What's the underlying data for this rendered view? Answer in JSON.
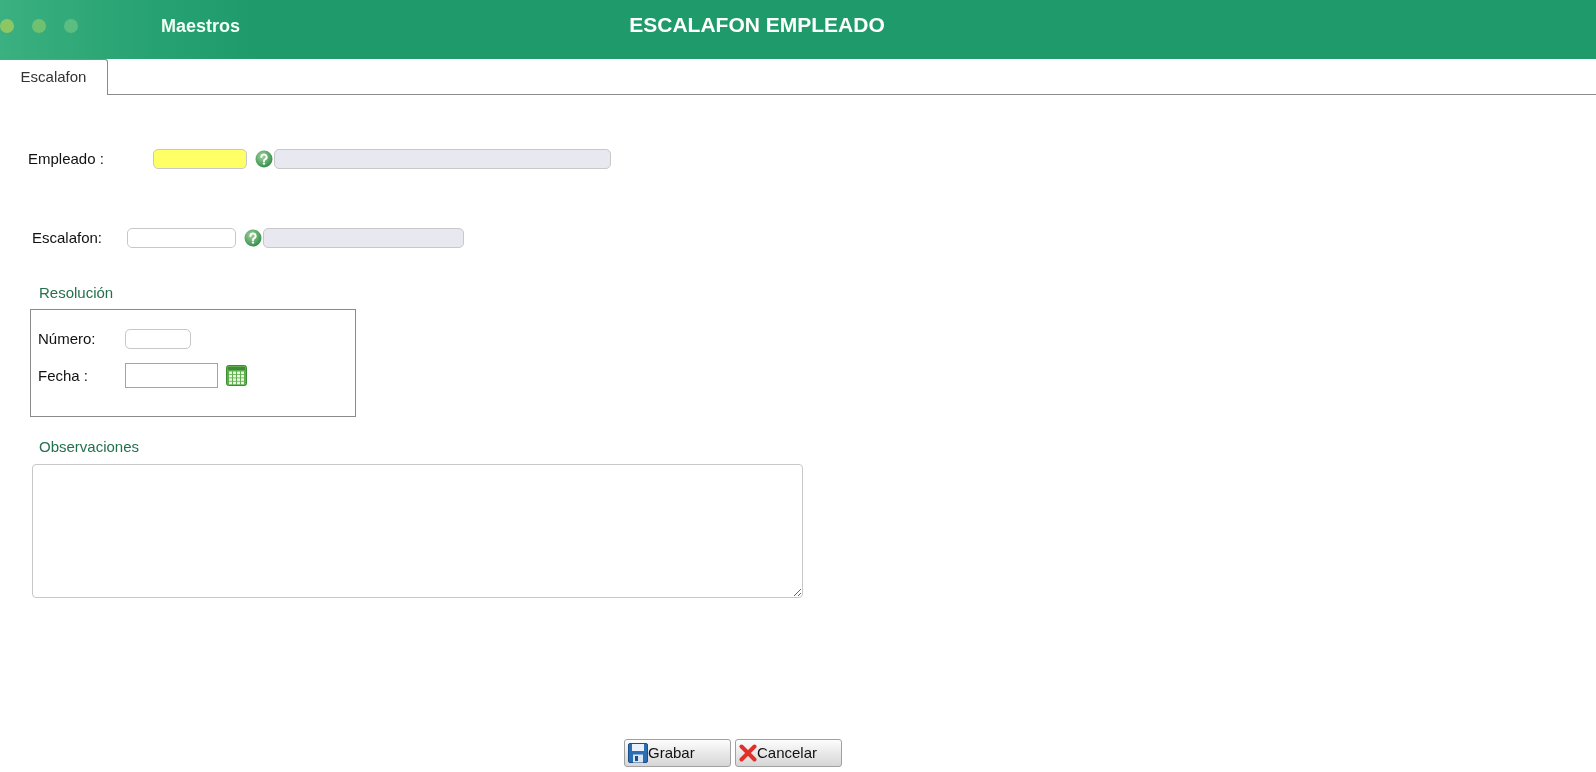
{
  "header": {
    "module": "Maestros",
    "title": "ESCALAFON EMPLEADO"
  },
  "tabs": [
    {
      "label": "Escalafon",
      "selected": true
    }
  ],
  "empleado": {
    "label": "Empleado :",
    "highlighted": true
  },
  "escalafon": {
    "label": "Escalafon:",
    "highlighted": false
  },
  "resolucion": {
    "legend": "Resolución",
    "numero_label": "Número:",
    "fecha_label": "Fecha :"
  },
  "observaciones": {
    "legend": "Observaciones"
  },
  "buttons": [
    {
      "label": "Grabar",
      "kind": "save"
    },
    {
      "label": "Cancelar",
      "kind": "cancel"
    }
  ]
}
